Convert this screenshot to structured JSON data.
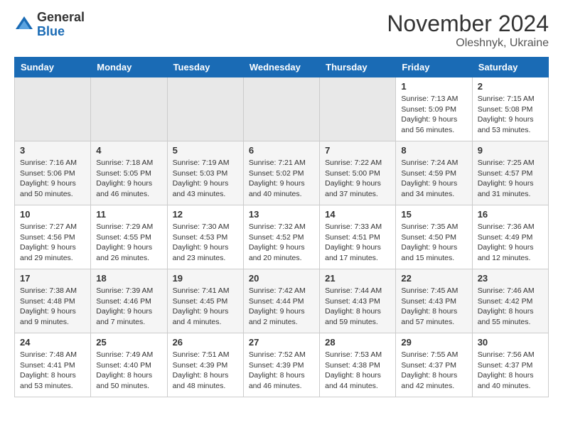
{
  "header": {
    "logo_general": "General",
    "logo_blue": "Blue",
    "month_title": "November 2024",
    "location": "Oleshnyk, Ukraine"
  },
  "days_of_week": [
    "Sunday",
    "Monday",
    "Tuesday",
    "Wednesday",
    "Thursday",
    "Friday",
    "Saturday"
  ],
  "weeks": [
    [
      {
        "day": "",
        "empty": true
      },
      {
        "day": "",
        "empty": true
      },
      {
        "day": "",
        "empty": true
      },
      {
        "day": "",
        "empty": true
      },
      {
        "day": "",
        "empty": true
      },
      {
        "day": "1",
        "sunrise": "Sunrise: 7:13 AM",
        "sunset": "Sunset: 5:09 PM",
        "daylight": "Daylight: 9 hours and 56 minutes."
      },
      {
        "day": "2",
        "sunrise": "Sunrise: 7:15 AM",
        "sunset": "Sunset: 5:08 PM",
        "daylight": "Daylight: 9 hours and 53 minutes."
      }
    ],
    [
      {
        "day": "3",
        "sunrise": "Sunrise: 7:16 AM",
        "sunset": "Sunset: 5:06 PM",
        "daylight": "Daylight: 9 hours and 50 minutes."
      },
      {
        "day": "4",
        "sunrise": "Sunrise: 7:18 AM",
        "sunset": "Sunset: 5:05 PM",
        "daylight": "Daylight: 9 hours and 46 minutes."
      },
      {
        "day": "5",
        "sunrise": "Sunrise: 7:19 AM",
        "sunset": "Sunset: 5:03 PM",
        "daylight": "Daylight: 9 hours and 43 minutes."
      },
      {
        "day": "6",
        "sunrise": "Sunrise: 7:21 AM",
        "sunset": "Sunset: 5:02 PM",
        "daylight": "Daylight: 9 hours and 40 minutes."
      },
      {
        "day": "7",
        "sunrise": "Sunrise: 7:22 AM",
        "sunset": "Sunset: 5:00 PM",
        "daylight": "Daylight: 9 hours and 37 minutes."
      },
      {
        "day": "8",
        "sunrise": "Sunrise: 7:24 AM",
        "sunset": "Sunset: 4:59 PM",
        "daylight": "Daylight: 9 hours and 34 minutes."
      },
      {
        "day": "9",
        "sunrise": "Sunrise: 7:25 AM",
        "sunset": "Sunset: 4:57 PM",
        "daylight": "Daylight: 9 hours and 31 minutes."
      }
    ],
    [
      {
        "day": "10",
        "sunrise": "Sunrise: 7:27 AM",
        "sunset": "Sunset: 4:56 PM",
        "daylight": "Daylight: 9 hours and 29 minutes."
      },
      {
        "day": "11",
        "sunrise": "Sunrise: 7:29 AM",
        "sunset": "Sunset: 4:55 PM",
        "daylight": "Daylight: 9 hours and 26 minutes."
      },
      {
        "day": "12",
        "sunrise": "Sunrise: 7:30 AM",
        "sunset": "Sunset: 4:53 PM",
        "daylight": "Daylight: 9 hours and 23 minutes."
      },
      {
        "day": "13",
        "sunrise": "Sunrise: 7:32 AM",
        "sunset": "Sunset: 4:52 PM",
        "daylight": "Daylight: 9 hours and 20 minutes."
      },
      {
        "day": "14",
        "sunrise": "Sunrise: 7:33 AM",
        "sunset": "Sunset: 4:51 PM",
        "daylight": "Daylight: 9 hours and 17 minutes."
      },
      {
        "day": "15",
        "sunrise": "Sunrise: 7:35 AM",
        "sunset": "Sunset: 4:50 PM",
        "daylight": "Daylight: 9 hours and 15 minutes."
      },
      {
        "day": "16",
        "sunrise": "Sunrise: 7:36 AM",
        "sunset": "Sunset: 4:49 PM",
        "daylight": "Daylight: 9 hours and 12 minutes."
      }
    ],
    [
      {
        "day": "17",
        "sunrise": "Sunrise: 7:38 AM",
        "sunset": "Sunset: 4:48 PM",
        "daylight": "Daylight: 9 hours and 9 minutes."
      },
      {
        "day": "18",
        "sunrise": "Sunrise: 7:39 AM",
        "sunset": "Sunset: 4:46 PM",
        "daylight": "Daylight: 9 hours and 7 minutes."
      },
      {
        "day": "19",
        "sunrise": "Sunrise: 7:41 AM",
        "sunset": "Sunset: 4:45 PM",
        "daylight": "Daylight: 9 hours and 4 minutes."
      },
      {
        "day": "20",
        "sunrise": "Sunrise: 7:42 AM",
        "sunset": "Sunset: 4:44 PM",
        "daylight": "Daylight: 9 hours and 2 minutes."
      },
      {
        "day": "21",
        "sunrise": "Sunrise: 7:44 AM",
        "sunset": "Sunset: 4:43 PM",
        "daylight": "Daylight: 8 hours and 59 minutes."
      },
      {
        "day": "22",
        "sunrise": "Sunrise: 7:45 AM",
        "sunset": "Sunset: 4:43 PM",
        "daylight": "Daylight: 8 hours and 57 minutes."
      },
      {
        "day": "23",
        "sunrise": "Sunrise: 7:46 AM",
        "sunset": "Sunset: 4:42 PM",
        "daylight": "Daylight: 8 hours and 55 minutes."
      }
    ],
    [
      {
        "day": "24",
        "sunrise": "Sunrise: 7:48 AM",
        "sunset": "Sunset: 4:41 PM",
        "daylight": "Daylight: 8 hours and 53 minutes."
      },
      {
        "day": "25",
        "sunrise": "Sunrise: 7:49 AM",
        "sunset": "Sunset: 4:40 PM",
        "daylight": "Daylight: 8 hours and 50 minutes."
      },
      {
        "day": "26",
        "sunrise": "Sunrise: 7:51 AM",
        "sunset": "Sunset: 4:39 PM",
        "daylight": "Daylight: 8 hours and 48 minutes."
      },
      {
        "day": "27",
        "sunrise": "Sunrise: 7:52 AM",
        "sunset": "Sunset: 4:39 PM",
        "daylight": "Daylight: 8 hours and 46 minutes."
      },
      {
        "day": "28",
        "sunrise": "Sunrise: 7:53 AM",
        "sunset": "Sunset: 4:38 PM",
        "daylight": "Daylight: 8 hours and 44 minutes."
      },
      {
        "day": "29",
        "sunrise": "Sunrise: 7:55 AM",
        "sunset": "Sunset: 4:37 PM",
        "daylight": "Daylight: 8 hours and 42 minutes."
      },
      {
        "day": "30",
        "sunrise": "Sunrise: 7:56 AM",
        "sunset": "Sunset: 4:37 PM",
        "daylight": "Daylight: 8 hours and 40 minutes."
      }
    ]
  ]
}
